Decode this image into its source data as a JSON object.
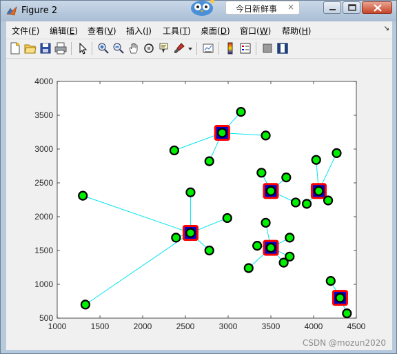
{
  "window": {
    "title": "Figure 2",
    "browser_tab_label": "今日新鲜事",
    "browser_tab_close": "×"
  },
  "menubar": {
    "items": [
      {
        "label": "文件(",
        "key": "F",
        "suffix": ")"
      },
      {
        "label": "编辑(",
        "key": "E",
        "suffix": ")"
      },
      {
        "label": "查看(",
        "key": "V",
        "suffix": ")"
      },
      {
        "label": "插入(",
        "key": "I",
        "suffix": ")"
      },
      {
        "label": "工具(",
        "key": "T",
        "suffix": ")"
      },
      {
        "label": "桌面(",
        "key": "D",
        "suffix": ")"
      },
      {
        "label": "窗口(",
        "key": "W",
        "suffix": ")"
      },
      {
        "label": "帮助(",
        "key": "H",
        "suffix": ")"
      }
    ],
    "overflow_glyph": "↘"
  },
  "toolbar": {
    "icons": [
      "new-figure-icon",
      "open-file-icon",
      "save-icon",
      "print-icon",
      "pointer-icon",
      "zoom-in-icon",
      "zoom-out-icon",
      "pan-icon",
      "rotate-3d-icon",
      "data-cursor-icon",
      "brush-icon",
      "brush-dropdown-icon",
      "link-plot-icon",
      "colorbar-icon",
      "legend-icon",
      "hide-plot-tools-icon",
      "show-plot-tools-icon"
    ]
  },
  "chart_data": {
    "type": "scatter",
    "xlim": [
      1000,
      4500
    ],
    "ylim": [
      500,
      4000
    ],
    "xticks": [
      1000,
      1500,
      2000,
      2500,
      3000,
      3500,
      4000,
      4500
    ],
    "yticks": [
      500,
      1000,
      1500,
      2000,
      2500,
      3000,
      3500,
      4000
    ],
    "grid": false,
    "colors": {
      "point_fill": "#00ee00",
      "point_edge": "#000000",
      "center_square": "#ff0000",
      "center_inner": "#0000cc",
      "link": "#00e5ee"
    },
    "clusters": [
      {
        "center": [
          2930,
          3240
        ],
        "points": [
          [
            2930,
            3240
          ],
          [
            3150,
            3550
          ],
          [
            3440,
            3200
          ],
          [
            2370,
            2980
          ],
          [
            2780,
            2820
          ]
        ]
      },
      {
        "center": [
          2560,
          1760
        ],
        "points": [
          [
            2560,
            1760
          ],
          [
            1300,
            2310
          ],
          [
            2560,
            2360
          ],
          [
            2990,
            1980
          ],
          [
            2390,
            1690
          ],
          [
            2780,
            1500
          ],
          [
            1330,
            700
          ]
        ]
      },
      {
        "center": [
          3500,
          2380
        ],
        "points": [
          [
            3500,
            2380
          ],
          [
            3390,
            2650
          ],
          [
            3680,
            2580
          ],
          [
            3790,
            2210
          ]
        ]
      },
      {
        "center": [
          4060,
          2380
        ],
        "points": [
          [
            4060,
            2380
          ],
          [
            4030,
            2840
          ],
          [
            4270,
            2940
          ],
          [
            3920,
            2190
          ],
          [
            4170,
            2240
          ]
        ]
      },
      {
        "center": [
          3500,
          1540
        ],
        "points": [
          [
            3500,
            1540
          ],
          [
            3440,
            1910
          ],
          [
            3720,
            1690
          ],
          [
            3340,
            1570
          ],
          [
            3720,
            1410
          ],
          [
            3650,
            1320
          ],
          [
            3240,
            1240
          ]
        ]
      },
      {
        "center": [
          4310,
          800
        ],
        "points": [
          [
            4310,
            800
          ],
          [
            4200,
            1050
          ],
          [
            4390,
            570
          ]
        ]
      }
    ]
  },
  "watermark": "CSDN @mozun2020"
}
